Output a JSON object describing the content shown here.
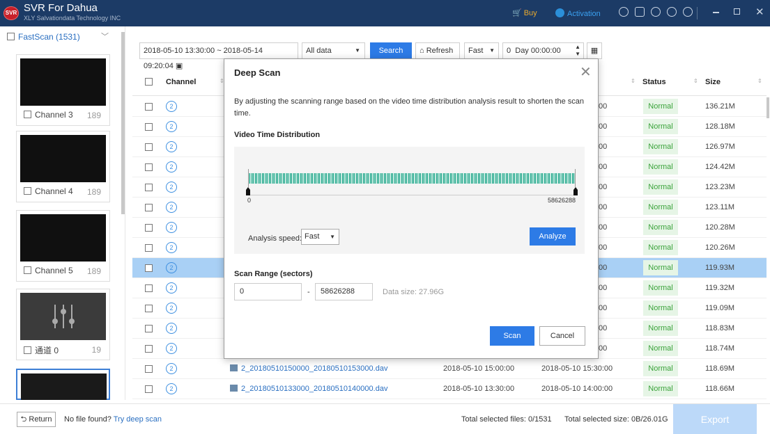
{
  "app": {
    "logo": "SVR",
    "title": "SVR For Dahua",
    "subtitle": "XLY Salvationdata Technology INC",
    "buy_label": "Buy",
    "activation_label": "Activation"
  },
  "sidebar": {
    "header": "FastScan (1531)",
    "items": [
      {
        "label": "Channel 3",
        "count": "189"
      },
      {
        "label": "Channel 4",
        "count": "189"
      },
      {
        "label": "Channel 5",
        "count": "189"
      },
      {
        "label": "通道 0",
        "count": "19"
      }
    ]
  },
  "toolbar": {
    "date_range": "2018-05-10 13:30:00 ~ 2018-05-14 09:20:04",
    "filter": "All data",
    "search_label": "Search",
    "refresh_label": "Refresh",
    "speed": "Fast",
    "day_value": "0",
    "day_label": "Day",
    "time_value": "00:00:00"
  },
  "table": {
    "headers": {
      "channel": "Channel",
      "status": "Status",
      "size": "Size"
    },
    "rows": [
      {
        "ch": "2",
        "end": "00",
        "status": "Normal",
        "size": "136.21M"
      },
      {
        "ch": "2",
        "end": "00",
        "status": "Normal",
        "size": "128.18M"
      },
      {
        "ch": "2",
        "end": "00",
        "status": "Normal",
        "size": "126.97M"
      },
      {
        "ch": "2",
        "end": "00",
        "status": "Normal",
        "size": "124.42M"
      },
      {
        "ch": "2",
        "end": "00",
        "status": "Normal",
        "size": "123.23M"
      },
      {
        "ch": "2",
        "end": "00",
        "status": "Normal",
        "size": "123.11M"
      },
      {
        "ch": "2",
        "end": "00",
        "status": "Normal",
        "size": "120.28M"
      },
      {
        "ch": "2",
        "end": "00",
        "status": "Normal",
        "size": "120.26M"
      },
      {
        "ch": "2",
        "end": "00",
        "status": "Normal",
        "size": "119.93M"
      },
      {
        "ch": "2",
        "end": "00",
        "status": "Normal",
        "size": "119.32M"
      },
      {
        "ch": "2",
        "end": "00",
        "status": "Normal",
        "size": "119.09M"
      },
      {
        "ch": "2",
        "end": "00",
        "status": "Normal",
        "size": "118.83M"
      },
      {
        "ch": "2",
        "end": "00",
        "status": "Normal",
        "size": "118.74M"
      },
      {
        "ch": "2",
        "name": "2_20180510150000_20180510153000.dav",
        "start": "2018-05-10 15:00:00",
        "end": "2018-05-10 15:30:00",
        "status": "Normal",
        "size": "118.69M"
      },
      {
        "ch": "2",
        "name": "2_20180510133000_20180510140000.dav",
        "start": "2018-05-10 13:30:00",
        "end": "2018-05-10 14:00:00",
        "status": "Normal",
        "size": "118.66M"
      }
    ]
  },
  "bottom": {
    "return_label": "Return",
    "no_file_text": "No file found?",
    "deep_scan_link": "Try deep scan",
    "total_files": "Total selected files: 0/1531",
    "total_size": "Total selected size: 0B/26.01G",
    "export_label": "Export"
  },
  "dialog": {
    "title": "Deep Scan",
    "description": "By adjusting the scanning range based on the video time distribution analysis result to shorten the scan time.",
    "distribution_title": "Video Time Distribution",
    "range_min": "0",
    "range_max": "58626288",
    "analysis_speed_label": "Analysis speed:",
    "analysis_speed": "Fast",
    "analyze_label": "Analyze",
    "scan_range_title": "Scan Range (sectors)",
    "scan_from": "0",
    "scan_to": "58626288",
    "data_size": "Data size: 27.96G",
    "scan_label": "Scan",
    "cancel_label": "Cancel"
  }
}
